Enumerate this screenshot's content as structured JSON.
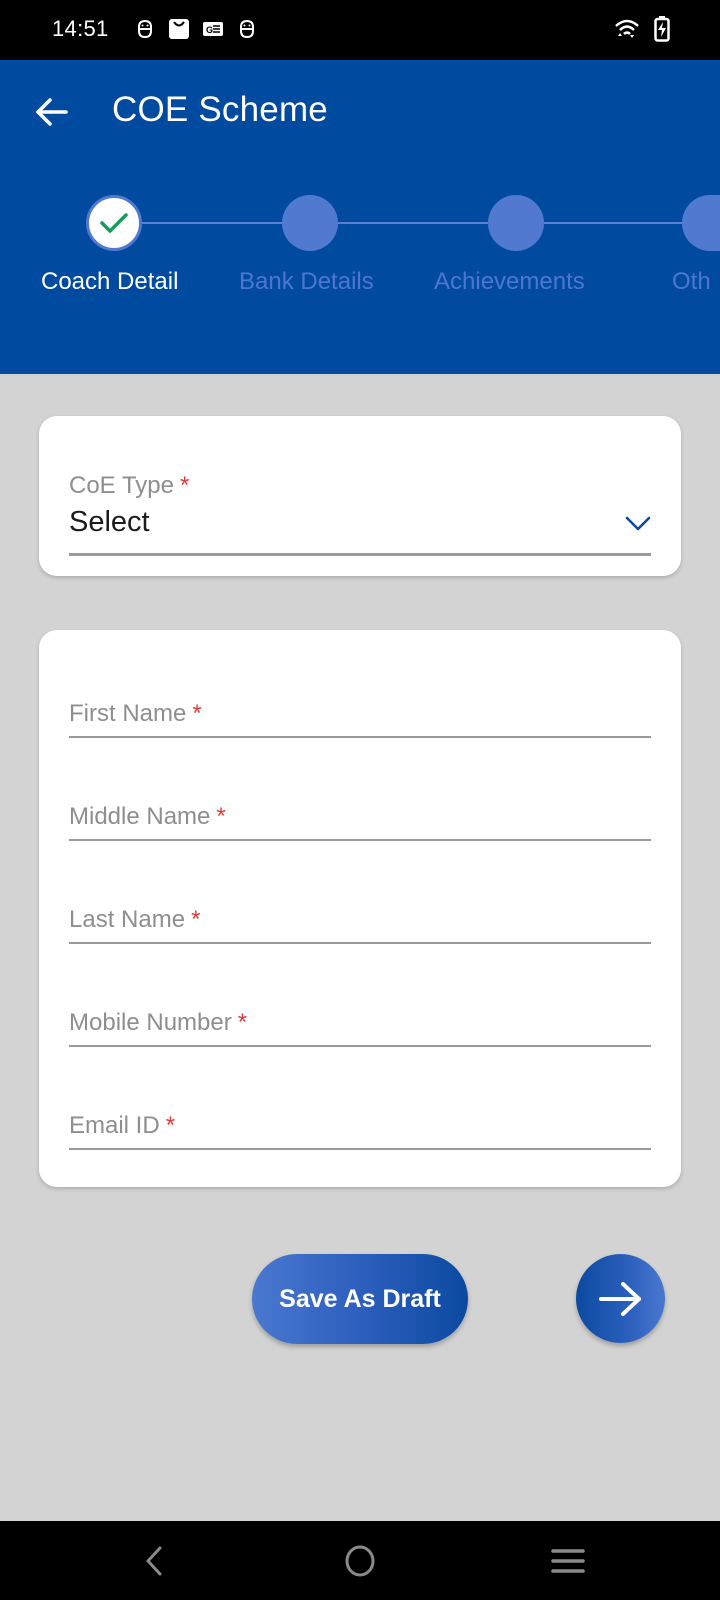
{
  "status_bar": {
    "time": "14:51",
    "left_icons": [
      "android-face-icon",
      "shopping-bag-icon",
      "news-card-icon",
      "android-face-icon"
    ],
    "right_icons": [
      "wifi-icon",
      "battery-charging-icon"
    ]
  },
  "header": {
    "title": "COE Scheme",
    "back_icon": "arrow-left-icon"
  },
  "stepper": {
    "steps": [
      {
        "label": "Coach Detail",
        "state": "completed"
      },
      {
        "label": "Bank Details",
        "state": "pending"
      },
      {
        "label": "Achievements",
        "state": "pending"
      },
      {
        "label": "Oth",
        "state": "pending"
      }
    ]
  },
  "coe_type": {
    "label": "CoE Type",
    "required_mark": "*",
    "value": "Select"
  },
  "personal_fields": [
    {
      "label": "First Name",
      "required_mark": "*",
      "value": ""
    },
    {
      "label": "Middle Name",
      "required_mark": "*",
      "value": ""
    },
    {
      "label": "Last Name",
      "required_mark": "*",
      "value": ""
    },
    {
      "label": "Mobile Number",
      "required_mark": "*",
      "value": ""
    },
    {
      "label": "Email ID",
      "required_mark": "*",
      "value": ""
    }
  ],
  "actions": {
    "save_draft_label": "Save As Draft",
    "next_icon": "arrow-right-icon"
  },
  "colors": {
    "primary": "#004aa0",
    "step_inactive": "#5179d0",
    "check": "#1a9a5a",
    "required": "#e33b3b",
    "background": "#d3d3d3"
  },
  "nav_bar": {
    "buttons": [
      "back-nav",
      "home-nav",
      "recents-nav"
    ]
  }
}
